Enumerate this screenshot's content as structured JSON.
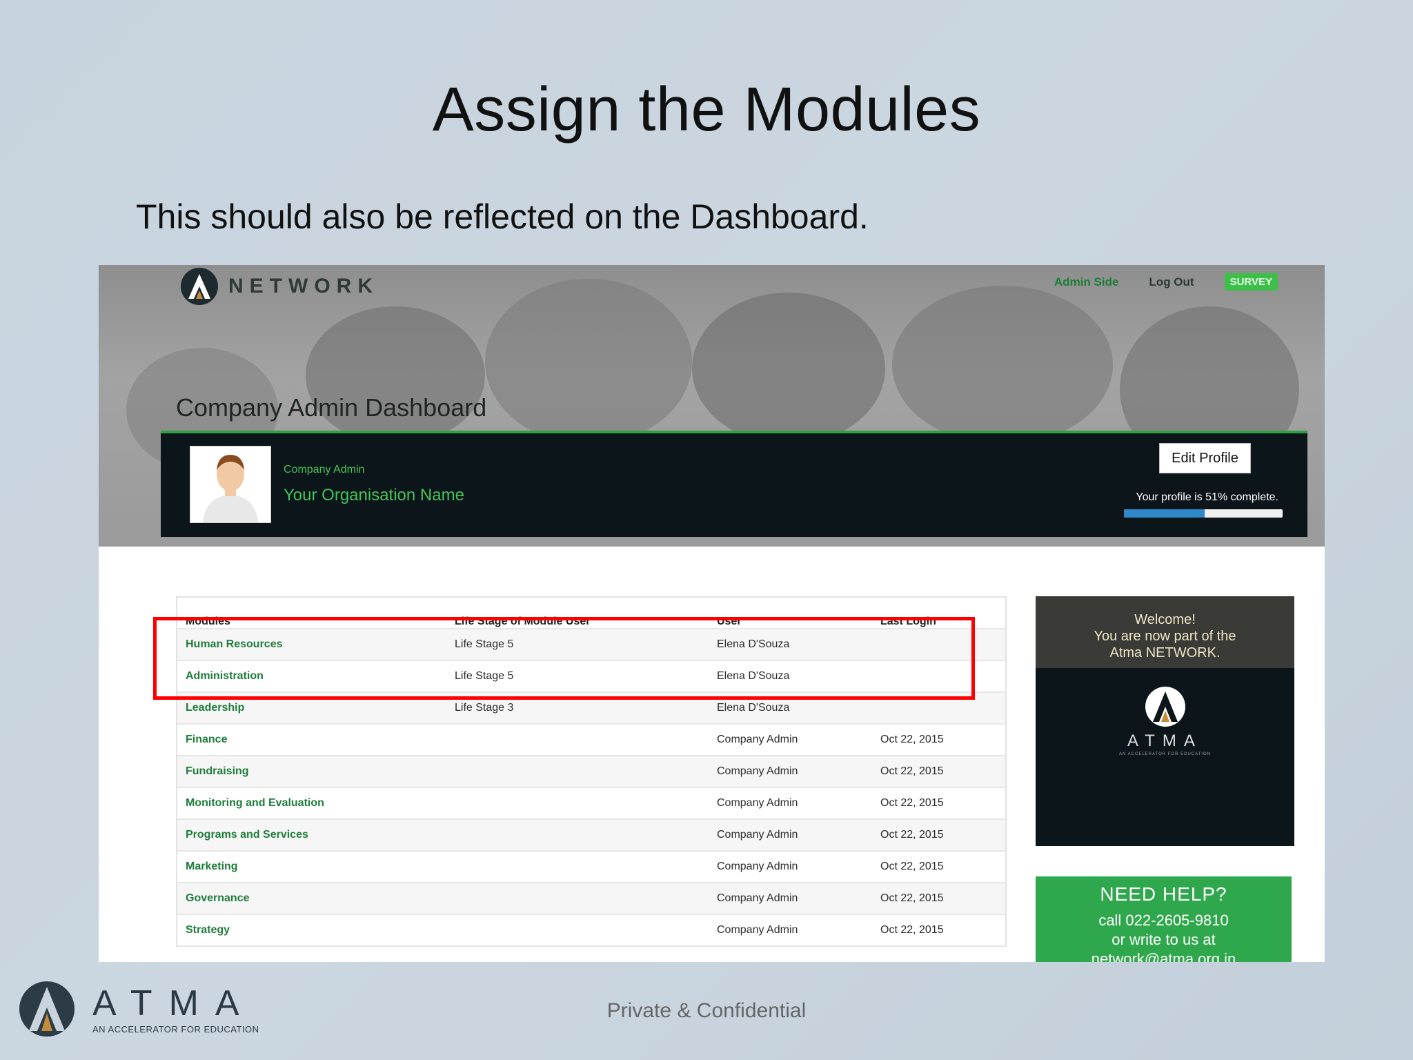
{
  "slide": {
    "title": "Assign the Modules",
    "subtitle": "This should also be reflected on the Dashboard."
  },
  "app": {
    "brand": "NETWORK",
    "nav": {
      "admin_side": "Admin Side",
      "log_out": "Log Out",
      "survey": "SURVEY"
    },
    "dashboard_title": "Company Admin Dashboard",
    "profile": {
      "role": "Company Admin",
      "org_name": "Your Organisation Name",
      "edit_button": "Edit Profile",
      "completion_text": "Your profile is 51% complete.",
      "completion_value": 0.51
    },
    "table": {
      "headers": [
        "Modules",
        "Life Stage of Module User",
        "User",
        "Last Login"
      ],
      "rows": [
        {
          "module": "Human Resources",
          "life_stage": "Life Stage 5",
          "user": "Elena D'Souza",
          "last_login": ""
        },
        {
          "module": "Administration",
          "life_stage": "Life Stage 5",
          "user": "Elena D'Souza",
          "last_login": ""
        },
        {
          "module": "Leadership",
          "life_stage": "Life Stage 3",
          "user": "Elena D'Souza",
          "last_login": ""
        },
        {
          "module": "Finance",
          "life_stage": "",
          "user": "Company Admin",
          "last_login": "Oct 22, 2015"
        },
        {
          "module": "Fundraising",
          "life_stage": "",
          "user": "Company Admin",
          "last_login": "Oct 22, 2015"
        },
        {
          "module": "Monitoring and Evaluation",
          "life_stage": "",
          "user": "Company Admin",
          "last_login": "Oct 22, 2015"
        },
        {
          "module": "Programs and Services",
          "life_stage": "",
          "user": "Company Admin",
          "last_login": "Oct 22, 2015"
        },
        {
          "module": "Marketing",
          "life_stage": "",
          "user": "Company Admin",
          "last_login": "Oct 22, 2015"
        },
        {
          "module": "Governance",
          "life_stage": "",
          "user": "Company Admin",
          "last_login": "Oct 22, 2015"
        },
        {
          "module": "Strategy",
          "life_stage": "",
          "user": "Company Admin",
          "last_login": "Oct 22, 2015"
        }
      ]
    },
    "welcome": {
      "line1": "Welcome!",
      "line2": "You are now part of the",
      "line3": "Atma NETWORK.",
      "logo_word": "ATMA",
      "logo_tagline": "AN ACCELERATOR FOR EDUCATION"
    },
    "help": {
      "title": "NEED HELP?",
      "line1": "call 022-2605-9810",
      "line2": "or write to us at",
      "line3": "network@atma.org.in"
    }
  },
  "footer": {
    "logo_word": "ATMA",
    "logo_tagline": "AN ACCELERATOR FOR EDUCATION",
    "note": "Private & Confidential"
  },
  "colors": {
    "accent_green": "#2fa84d",
    "dark_panel": "#0c1519",
    "highlight_red": "#ff0000",
    "progress_blue": "#2f88c8"
  }
}
